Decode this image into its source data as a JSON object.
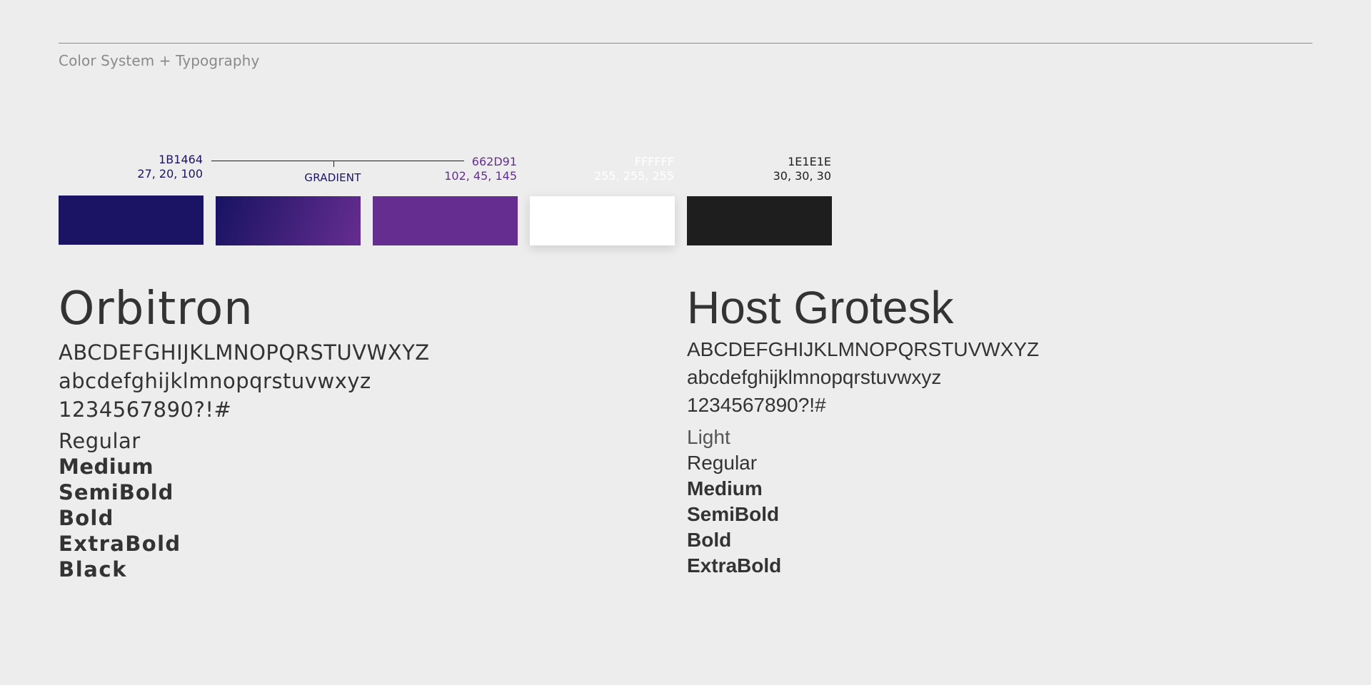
{
  "header": {
    "title": "Color System + Typography"
  },
  "colors": {
    "gradient_label": "GRADIENT",
    "swatches": [
      {
        "hex": "1B1464",
        "rgb": "27, 20, 100",
        "color": "#1b1464"
      },
      {
        "hex": "",
        "rgb": "",
        "color": "gradient"
      },
      {
        "hex": "662D91",
        "rgb": "102, 45, 145",
        "color": "#662d91"
      },
      {
        "hex": "FFFFFF",
        "rgb": "255, 255, 255",
        "color": "#ffffff"
      },
      {
        "hex": "1E1E1E",
        "rgb": "30, 30, 30",
        "color": "#1e1e1e"
      }
    ]
  },
  "typefaces": {
    "orbitron": {
      "name": "Orbitron",
      "uppercase": "ABCDEFGHIJKLMNOPQRSTUVWXYZ",
      "lowercase": "abcdefghijklmnopqrstuvwxyz",
      "numerals": "1234567890?!#",
      "weights": [
        "Regular",
        "Medium",
        "SemiBold",
        "Bold",
        "ExtraBold",
        "Black"
      ]
    },
    "host_grotesk": {
      "name": "Host Grotesk",
      "uppercase": "ABCDEFGHIJKLMNOPQRSTUVWXYZ",
      "lowercase": "abcdefghijklmnopqrstuvwxyz",
      "numerals": "1234567890?!#",
      "weights": [
        "Light",
        "Regular",
        "Medium",
        "SemiBold",
        "Bold",
        "ExtraBold"
      ]
    }
  }
}
